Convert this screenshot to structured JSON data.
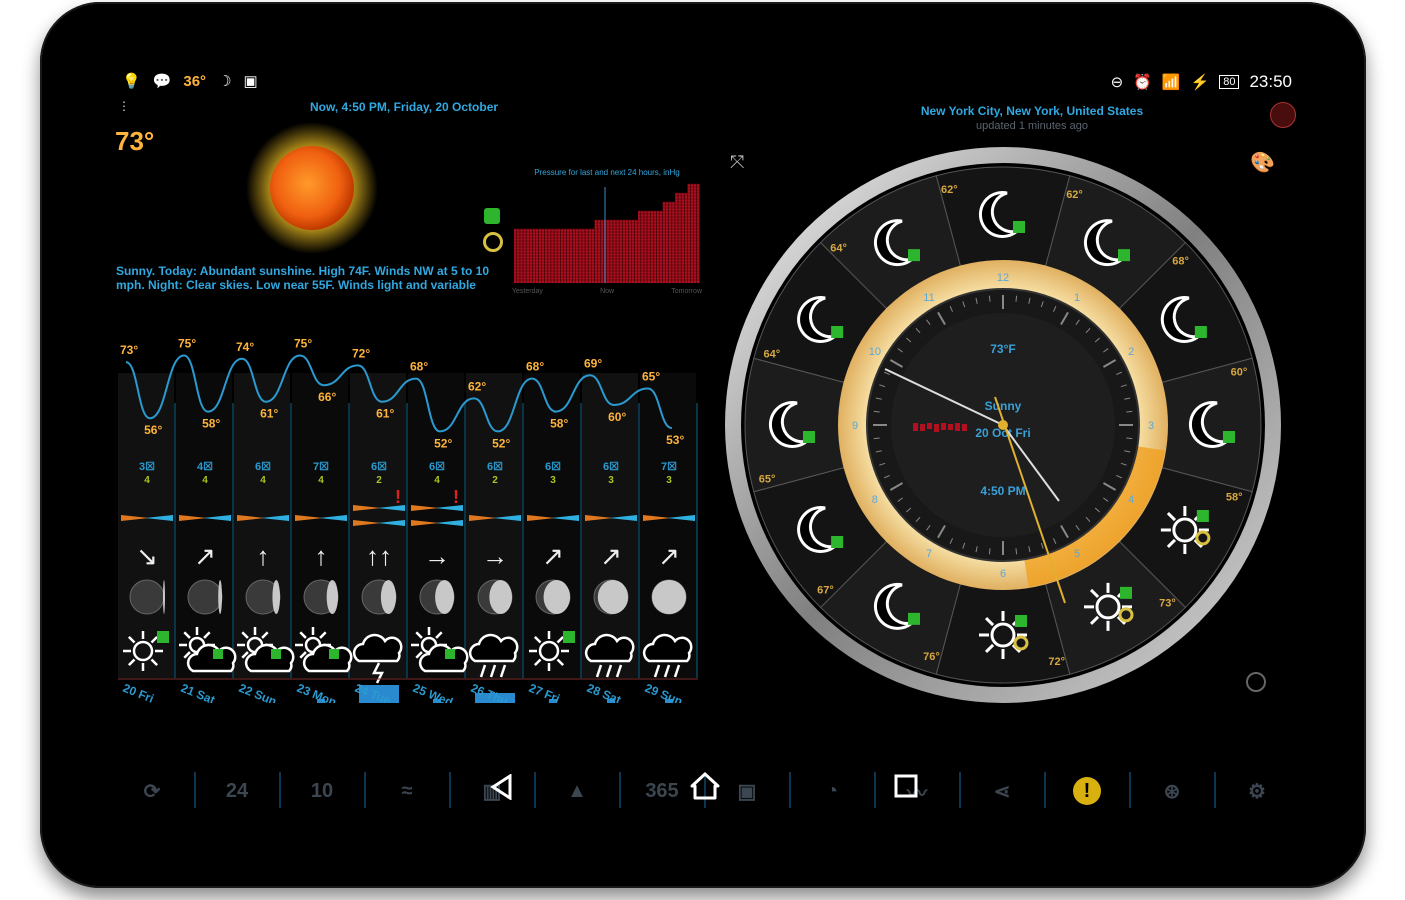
{
  "status_bar": {
    "left_temp": "36°",
    "time": "23:50",
    "battery": "80"
  },
  "current": {
    "temperature": "73°",
    "datetime": "Now, 4:50 PM, Friday, 20 October",
    "forecast_text": "Sunny. Today: Abundant sunshine. High 74F. Winds NW at 5 to 10 mph. Night: Clear skies. Low near 55F. Winds light and variable"
  },
  "location": {
    "name": "New York City, New York, United States",
    "updated": "updated 1 minutes ago"
  },
  "pressure_chart": {
    "title": "Pressure for last and next 24 hours, inHg",
    "labels": [
      "Yesterday",
      "Now",
      "Tomorrow"
    ],
    "values": [
      6,
      6,
      6,
      6,
      6,
      6,
      6,
      6,
      6,
      6,
      6,
      6,
      6,
      6,
      6,
      6,
      6,
      6,
      6,
      6,
      6,
      6,
      6,
      6,
      6,
      6,
      7,
      7,
      7,
      7,
      7,
      7,
      7,
      7,
      7,
      7,
      7,
      7,
      7,
      7,
      8,
      8,
      8,
      8,
      8,
      8,
      8,
      8,
      9,
      9,
      9,
      9,
      10,
      10,
      10,
      10,
      11,
      11,
      11,
      11
    ]
  },
  "forecast_chart": {
    "highs": [
      "73°",
      "75°",
      "74°",
      "75°",
      "72°",
      "68°",
      "62°",
      "68°",
      "69°",
      "65°"
    ],
    "lows": [
      "56°",
      "58°",
      "61°",
      "66°",
      "61°",
      "52°",
      "52°",
      "58°",
      "60°",
      "53°"
    ],
    "wind_speeds": [
      "3☒",
      "4☒",
      "6☒",
      "7☒",
      "6☒",
      "6☒",
      "6☒",
      "6☒",
      "6☒",
      "7☒"
    ],
    "uv": [
      "4",
      "4",
      "4",
      "4",
      "2",
      "4",
      "2",
      "3",
      "3",
      "3"
    ],
    "days": [
      "20 Fri",
      "21 Sat",
      "22 Sun",
      "23 Mon",
      "24 Tue",
      "25 Wed",
      "26 Thu",
      "27 Fri",
      "28 Sat",
      "29 Sun"
    ],
    "wind_arrows": [
      "↘",
      "↗",
      "↑",
      "↑",
      "↑↑",
      "→",
      "→",
      "↗",
      "↗",
      "↗"
    ],
    "icons": [
      "sun",
      "partly",
      "partly",
      "partly",
      "storm",
      "partly",
      "rain",
      "sun",
      "rain",
      "rain"
    ],
    "precip": [
      0,
      0,
      0,
      0.35,
      0.7,
      0.35,
      0.5,
      0.35,
      0.35,
      0.35
    ]
  },
  "clock": {
    "center_temp": "73°F",
    "condition": "Sunny",
    "date": "20 Oct Fri",
    "time": "4:50 PM",
    "hour_numbers": [
      "12",
      "1",
      "2",
      "3",
      "4",
      "5",
      "6",
      "7",
      "8",
      "9",
      "10",
      "11"
    ],
    "ring_temps": [
      "62°",
      "68°",
      "60°",
      "58°",
      "73°",
      "72°",
      "76°",
      "67°",
      "65°",
      "64°",
      "64°",
      "62°"
    ],
    "ring_icons": [
      "moon",
      "moon",
      "moon",
      "moon",
      "sun",
      "sun",
      "sun",
      "moon",
      "moon",
      "moon",
      "moon",
      "moon"
    ]
  },
  "toolbar": {
    "items": [
      "refresh",
      "24",
      "10",
      "waves",
      "chart",
      "mountain",
      "365",
      "photo",
      "rss",
      "pulse",
      "share",
      "alert",
      "help",
      "settings"
    ]
  }
}
